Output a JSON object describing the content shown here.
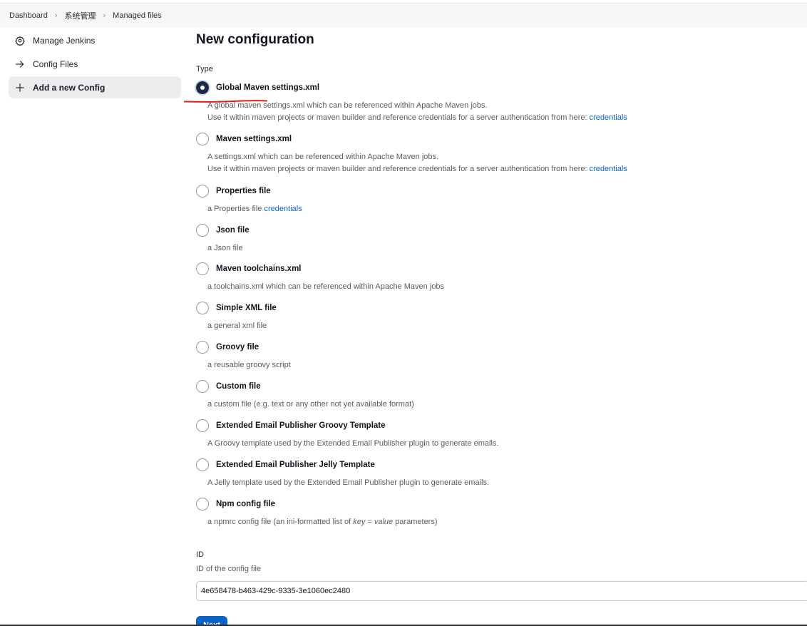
{
  "breadcrumb": {
    "items": [
      "Dashboard",
      "系统管理",
      "Managed files"
    ]
  },
  "sidebar": {
    "items": [
      {
        "label": "Manage Jenkins",
        "icon": "gear-icon"
      },
      {
        "label": "Config Files",
        "icon": "arrow-right-icon"
      },
      {
        "label": "Add a new Config",
        "icon": "plus-icon",
        "active": true
      }
    ]
  },
  "main": {
    "title": "New configuration",
    "type_label": "Type",
    "options": [
      {
        "label": "Global Maven settings.xml",
        "checked": true,
        "desc1": "A global maven settings.xml which can be referenced within Apache Maven jobs.",
        "desc2": "Use it within maven projects or maven builder and reference credentials for a server authentication from here:",
        "link": "credentials"
      },
      {
        "label": "Maven settings.xml",
        "checked": false,
        "desc1": "A settings.xml which can be referenced within Apache Maven jobs.",
        "desc2": "Use it within maven projects or maven builder and reference credentials for a server authentication from here:",
        "link": "credentials"
      },
      {
        "label": "Properties file",
        "checked": false,
        "desc1": "a Properties file",
        "link": "credentials"
      },
      {
        "label": "Json file",
        "checked": false,
        "desc1": "a Json file"
      },
      {
        "label": "Maven toolchains.xml",
        "checked": false,
        "desc1": "a toolchains.xml which can be referenced within Apache Maven jobs"
      },
      {
        "label": "Simple XML file",
        "checked": false,
        "desc1": "a general xml file"
      },
      {
        "label": "Groovy file",
        "checked": false,
        "desc1": "a reusable groovy script"
      },
      {
        "label": "Custom file",
        "checked": false,
        "desc1": "a custom file (e.g. text or any other not yet available format)"
      },
      {
        "label": "Extended Email Publisher Groovy Template",
        "checked": false,
        "desc1": "A Groovy template used by the Extended Email Publisher plugin to generate emails."
      },
      {
        "label": "Extended Email Publisher Jelly Template",
        "checked": false,
        "desc1": "A Jelly template used by the Extended Email Publisher plugin to generate emails."
      },
      {
        "label": "Npm config file",
        "checked": false,
        "desc_prefix": "a npmrc config file (an ini-formatted list of ",
        "desc_em": "key = value",
        "desc_suffix": " parameters)"
      }
    ],
    "id_label": "ID",
    "id_help": "ID of the config file",
    "id_value": "4e658478-b463-429c-9335-3e1060ec2480",
    "next_label": "Next"
  },
  "colors": {
    "accent": "#0b63c4",
    "radio_checked": "#1a2b45",
    "annotation": "#e02020"
  }
}
